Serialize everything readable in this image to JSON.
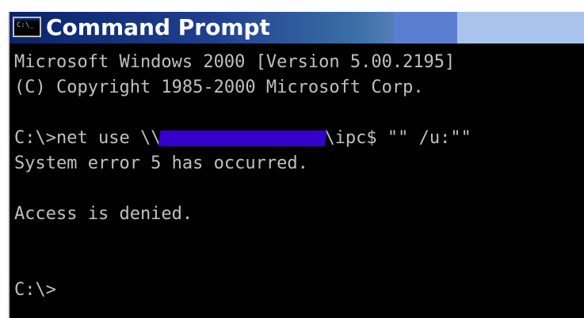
{
  "window": {
    "title": "Command Prompt",
    "icon": "cmd-icon",
    "icon_glyph": "C:\\_"
  },
  "console": {
    "line1": "Microsoft Windows 2000 [Version 5.00.2195]",
    "line2": "(C) Copyright 1985-2000 Microsoft Corp.",
    "command_prefix": "C:\\>net use \\\\",
    "command_suffix": "\\ipc$ \"\" /u:\"\"",
    "error_line": "System error 5 has occurred.",
    "denied_line": "Access is denied.",
    "prompt": "C:\\>"
  },
  "colors": {
    "console_bg": "#000000",
    "console_text": "#c0c0c0",
    "titlebar_start": "#0a246a",
    "redaction": "#3300cc"
  }
}
